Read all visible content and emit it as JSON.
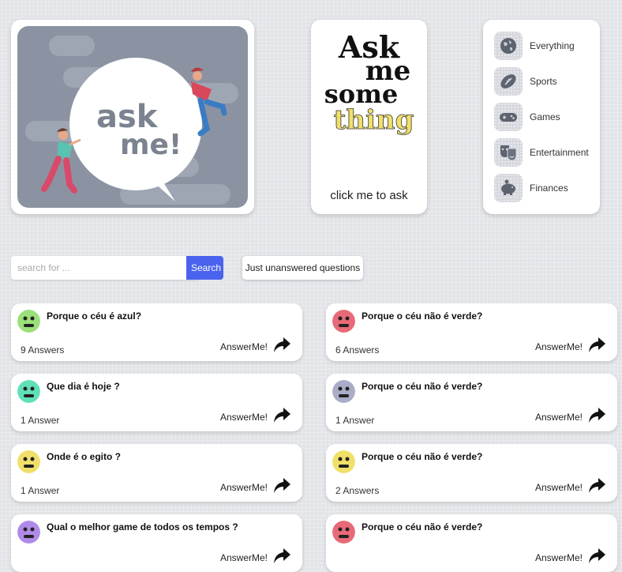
{
  "hero": {
    "bubble_line1": "ask",
    "bubble_line2": "me!"
  },
  "ask_card": {
    "line1": "Ask",
    "line2": "me",
    "line3": "some",
    "line4": "thing",
    "cta": "click me to ask"
  },
  "categories": [
    {
      "label": "Everything",
      "icon": "globe-icon"
    },
    {
      "label": "Sports",
      "icon": "football-icon"
    },
    {
      "label": "Games",
      "icon": "gamepad-icon"
    },
    {
      "label": "Entertainment",
      "icon": "theater-masks-icon"
    },
    {
      "label": "Finances",
      "icon": "piggy-bank-icon"
    }
  ],
  "search": {
    "placeholder": "search for ...",
    "button": "Search"
  },
  "filter": {
    "unanswered": "Just unanswered questions"
  },
  "answer_label": "AnswerMe!",
  "colors": {
    "accent": "#4a63ee"
  },
  "questions": [
    {
      "title": "Porque o céu é azul?",
      "answers": "9 Answers",
      "avatar_color": "#9be07a"
    },
    {
      "title": "Porque o céu não é verde?",
      "answers": "6 Answers",
      "avatar_color": "#e86a78"
    },
    {
      "title": "Que dia é hoje ?",
      "answers": "1 Answer",
      "avatar_color": "#5fe0b8"
    },
    {
      "title": "Porque o céu não é verde?",
      "answers": "1 Answer",
      "avatar_color": "#a9adc8"
    },
    {
      "title": "Onde é o egito ?",
      "answers": "1 Answer",
      "avatar_color": "#f0e06a"
    },
    {
      "title": "Porque o céu não é verde?",
      "answers": "2 Answers",
      "avatar_color": "#f0e06a"
    },
    {
      "title": "Qual o melhor game de todos os tempos ?",
      "answers": "",
      "avatar_color": "#b08ae8"
    },
    {
      "title": "Porque o céu não é verde?",
      "answers": "",
      "avatar_color": "#e86a78"
    }
  ]
}
